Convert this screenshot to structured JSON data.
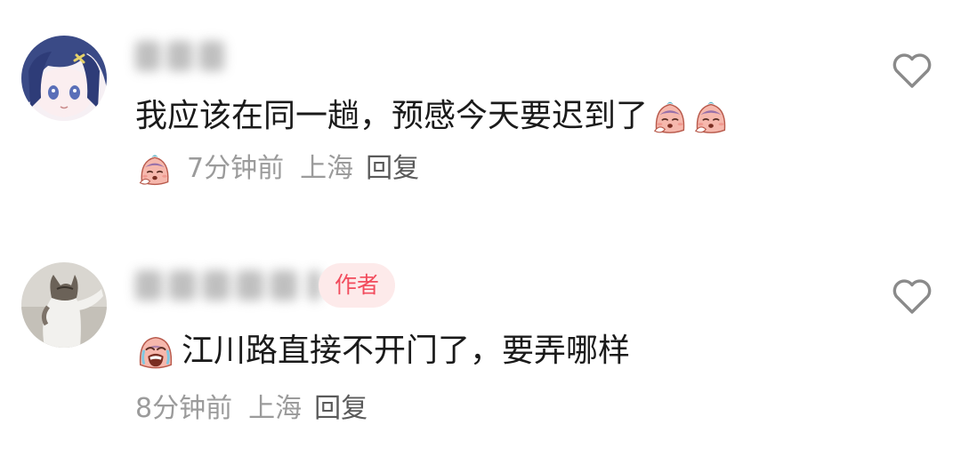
{
  "comments": [
    {
      "text": "我应该在同一趟，预感今天要迟到了",
      "time": "7分钟前",
      "location": "上海",
      "reply_label": "回复",
      "icons": {
        "avatar": "anime-girl-avatar",
        "like": "heart-outline-icon",
        "reaction": "sad-face-emoji"
      }
    },
    {
      "author_badge": "作者",
      "text": "江川路直接不开门了，要弄哪样",
      "time": "8分钟前",
      "location": "上海",
      "reply_label": "回复",
      "icons": {
        "avatar": "cat-photo-avatar",
        "like": "heart-outline-icon",
        "reaction": "crying-face-emoji"
      }
    }
  ],
  "colors": {
    "text": "#1a1a1a",
    "meta": "#9b9b9b",
    "badge_bg": "#fdeaea",
    "badge_text": "#f24c5d"
  }
}
